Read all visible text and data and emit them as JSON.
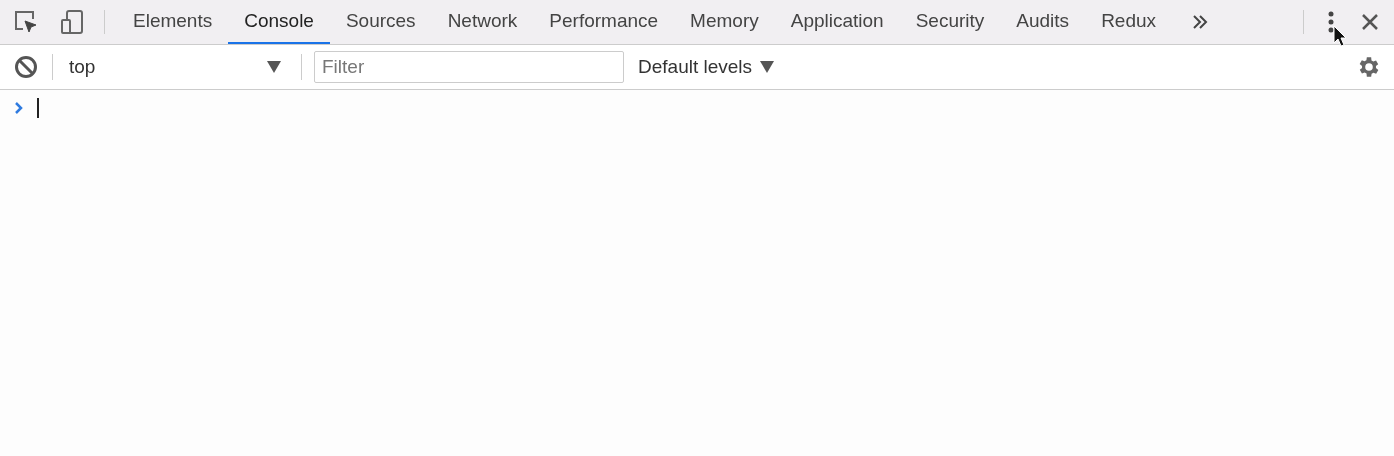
{
  "tabs": [
    {
      "label": "Elements",
      "selected": false
    },
    {
      "label": "Console",
      "selected": true
    },
    {
      "label": "Sources",
      "selected": false
    },
    {
      "label": "Network",
      "selected": false
    },
    {
      "label": "Performance",
      "selected": false
    },
    {
      "label": "Memory",
      "selected": false
    },
    {
      "label": "Application",
      "selected": false
    },
    {
      "label": "Security",
      "selected": false
    },
    {
      "label": "Audits",
      "selected": false
    },
    {
      "label": "Redux",
      "selected": false
    }
  ],
  "toolbar": {
    "context": "top",
    "filter": {
      "placeholder": "Filter"
    },
    "levels": "Default levels"
  }
}
